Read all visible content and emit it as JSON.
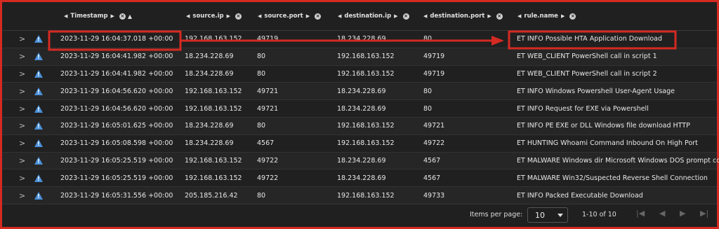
{
  "columns": [
    {
      "key": "timestamp",
      "label": "Timestamp"
    },
    {
      "key": "source_ip",
      "label": "source.ip"
    },
    {
      "key": "source_port",
      "label": "source.port"
    },
    {
      "key": "destination_ip",
      "label": "destination.ip"
    },
    {
      "key": "destination_port",
      "label": "destination.port"
    },
    {
      "key": "rule_name",
      "label": "rule.name"
    }
  ],
  "rows": [
    {
      "timestamp": "2023-11-29 16:04:37.018 +00:00",
      "source_ip": "192.168.163.152",
      "source_port": "49719",
      "destination_ip": "18.234.228.69",
      "destination_port": "80",
      "rule_name": "ET INFO Possible HTA Application Download"
    },
    {
      "timestamp": "2023-11-29 16:04:41.982 +00:00",
      "source_ip": "18.234.228.69",
      "source_port": "80",
      "destination_ip": "192.168.163.152",
      "destination_port": "49719",
      "rule_name": "ET WEB_CLIENT PowerShell call in script 1"
    },
    {
      "timestamp": "2023-11-29 16:04:41.982 +00:00",
      "source_ip": "18.234.228.69",
      "source_port": "80",
      "destination_ip": "192.168.163.152",
      "destination_port": "49719",
      "rule_name": "ET WEB_CLIENT PowerShell call in script 2"
    },
    {
      "timestamp": "2023-11-29 16:04:56.620 +00:00",
      "source_ip": "192.168.163.152",
      "source_port": "49721",
      "destination_ip": "18.234.228.69",
      "destination_port": "80",
      "rule_name": "ET INFO Windows Powershell User-Agent Usage"
    },
    {
      "timestamp": "2023-11-29 16:04:56.620 +00:00",
      "source_ip": "192.168.163.152",
      "source_port": "49721",
      "destination_ip": "18.234.228.69",
      "destination_port": "80",
      "rule_name": "ET INFO Request for EXE via Powershell"
    },
    {
      "timestamp": "2023-11-29 16:05:01.625 +00:00",
      "source_ip": "18.234.228.69",
      "source_port": "80",
      "destination_ip": "192.168.163.152",
      "destination_port": "49721",
      "rule_name": "ET INFO PE EXE or DLL Windows file download HTTP"
    },
    {
      "timestamp": "2023-11-29 16:05:08.598 +00:00",
      "source_ip": "18.234.228.69",
      "source_port": "4567",
      "destination_ip": "192.168.163.152",
      "destination_port": "49722",
      "rule_name": "ET HUNTING Whoami Command Inbound On High Port"
    },
    {
      "timestamp": "2023-11-29 16:05:25.519 +00:00",
      "source_ip": "192.168.163.152",
      "source_port": "49722",
      "destination_ip": "18.234.228.69",
      "destination_port": "4567",
      "rule_name": "ET MALWARE Windows dir Microsoft Windows DOS prompt cor"
    },
    {
      "timestamp": "2023-11-29 16:05:25.519 +00:00",
      "source_ip": "192.168.163.152",
      "source_port": "49722",
      "destination_ip": "18.234.228.69",
      "destination_port": "4567",
      "rule_name": "ET MALWARE Win32/Suspected Reverse Shell Connection"
    },
    {
      "timestamp": "2023-11-29 16:05:31.556 +00:00",
      "source_ip": "205.185.216.42",
      "source_port": "80",
      "destination_ip": "192.168.163.152",
      "destination_port": "49733",
      "rule_name": "ET INFO Packed Executable Download"
    }
  ],
  "pagination": {
    "items_per_page_label": "Items per page:",
    "items_per_page_value": "10",
    "range_text": "1-10 of 10"
  },
  "icons": {
    "expand": "chevron-right-icon",
    "alert": "warning-triangle-icon",
    "remove_column": "close-circle-icon",
    "move_left": "caret-left-icon",
    "move_right": "caret-right-icon",
    "sort": "sort-asc-icon"
  },
  "colors": {
    "alert_icon": "#4a90d9",
    "highlight_annotation": "#d42a22",
    "background": "#202020"
  }
}
